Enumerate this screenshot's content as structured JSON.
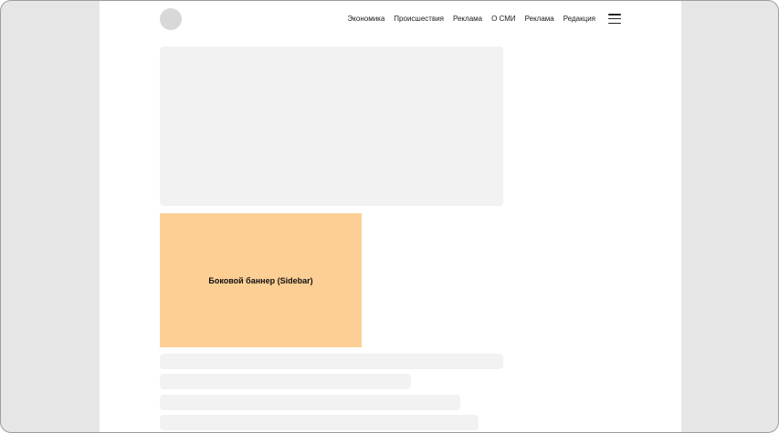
{
  "nav": {
    "items": [
      "Экономика",
      "Происшествия",
      "Реклама",
      "О СМИ",
      "Реклама",
      "Редакция"
    ]
  },
  "icons": {
    "logo": "logo-placeholder",
    "menu": "hamburger-menu-icon"
  },
  "banner": {
    "label": "Боковой баннер (Sidebar)",
    "color": "#fecf95"
  },
  "colors": {
    "placeholder": "#f2f2f2",
    "side": "#e6e6e6"
  }
}
